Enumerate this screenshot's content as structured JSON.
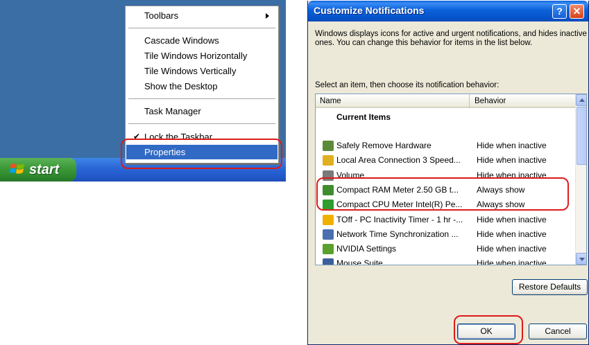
{
  "taskbar_menu": {
    "items": [
      {
        "label": "Toolbars",
        "submenu": true
      },
      {
        "label": "Cascade Windows"
      },
      {
        "label": "Tile Windows Horizontally"
      },
      {
        "label": "Tile Windows Vertically"
      },
      {
        "label": "Show the Desktop"
      },
      {
        "label": "Task Manager"
      },
      {
        "label": "Lock the Taskbar",
        "checked": true
      },
      {
        "label": "Properties",
        "selected": true
      }
    ]
  },
  "start_button": {
    "label": "start"
  },
  "dialog": {
    "title": "Customize Notifications",
    "help_glyph": "?",
    "close_glyph": "✕",
    "description": "Windows displays icons for active and urgent notifications, and hides inactive ones. You can change this behavior for items in the list below.",
    "select_label": "Select an item, then choose its notification behavior:",
    "columns": {
      "name": "Name",
      "behavior": "Behavior"
    },
    "group_label": "Current Items",
    "items": [
      {
        "name": "Safely Remove Hardware",
        "behavior": "Hide when inactive",
        "icon": "usb-plug-icon",
        "color": "#5d8a3a"
      },
      {
        "name": "Local Area Connection 3 Speed...",
        "behavior": "Hide when inactive",
        "icon": "network-warning-icon",
        "color": "#e0b020"
      },
      {
        "name": "Volume",
        "behavior": "Hide when inactive",
        "icon": "speaker-icon",
        "color": "#7a7a7a"
      },
      {
        "name": "Compact RAM Meter 2.50 GB t...",
        "behavior": "Always show",
        "icon": "ram-meter-icon",
        "color": "#3f8c2f"
      },
      {
        "name": "Compact CPU Meter Intel(R) Pe...",
        "behavior": "Always show",
        "icon": "cpu-meter-icon",
        "color": "#2f9d2f"
      },
      {
        "name": "TOff - PC Inactivity Timer - 1 hr -...",
        "behavior": "Hide when inactive",
        "icon": "timer-icon",
        "color": "#f0b000"
      },
      {
        "name": "Network Time Synchronization ...",
        "behavior": "Hide when inactive",
        "icon": "clock-icon",
        "color": "#4a6fb0"
      },
      {
        "name": "NVIDIA Settings",
        "behavior": "Hide when inactive",
        "icon": "nvidia-icon",
        "color": "#5aa02c"
      },
      {
        "name": "Mouse Suite",
        "behavior": "Hide when inactive",
        "icon": "mouse-icon",
        "color": "#3b5f9a"
      }
    ],
    "buttons": {
      "restore": "Restore Defaults",
      "ok": "OK",
      "cancel": "Cancel"
    }
  },
  "colors": {
    "highlight": "#dd1a1a",
    "selection": "#316ac5",
    "taskbar": "#245ccd",
    "start": "#3e9c3a"
  }
}
